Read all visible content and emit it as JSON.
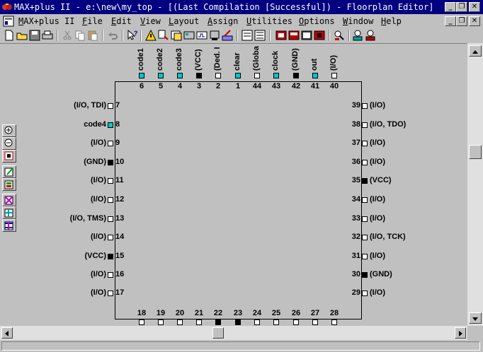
{
  "window": {
    "title": "MAX+plus II - e:\\new\\my_top - [(Last Compilation [Successful]) - Floorplan Editor]",
    "minimize_glyph": "_",
    "restore_glyph": "❐",
    "close_glyph": "✕"
  },
  "menu": {
    "items": [
      {
        "label": "MAX+plus II"
      },
      {
        "label": "File"
      },
      {
        "label": "Edit"
      },
      {
        "label": "View"
      },
      {
        "label": "Layout"
      },
      {
        "label": "Assign"
      },
      {
        "label": "Utilities"
      },
      {
        "label": "Options"
      },
      {
        "label": "Window"
      },
      {
        "label": "Help"
      }
    ]
  },
  "chip": {
    "top_pins": [
      {
        "num": "6",
        "label": "code1",
        "fill": "#00c8c8"
      },
      {
        "num": "5",
        "label": "code2",
        "fill": "#00c8c8"
      },
      {
        "num": "4",
        "label": "code3",
        "fill": "#00c8c8"
      },
      {
        "num": "3",
        "label": "(VCC)",
        "fill": "#000000"
      },
      {
        "num": "2",
        "label": "(Ded. I",
        "fill": "#ffffff"
      },
      {
        "num": "1",
        "label": "clear",
        "fill": "#00c8c8"
      },
      {
        "num": "44",
        "label": "(Globa",
        "fill": "#ffffff"
      },
      {
        "num": "43",
        "label": "clock",
        "fill": "#00c8c8"
      },
      {
        "num": "42",
        "label": "(GND)",
        "fill": "#000000"
      },
      {
        "num": "41",
        "label": "out",
        "fill": "#00c8c8"
      },
      {
        "num": "40",
        "label": "(I/O)",
        "fill": "#ffffff"
      }
    ],
    "left_pins": [
      {
        "num": "7",
        "label": "(I/O, TDI)",
        "fill": "#ffffff"
      },
      {
        "num": "8",
        "label": "code4",
        "fill": "#00c8c8"
      },
      {
        "num": "9",
        "label": "(I/O)",
        "fill": "#ffffff"
      },
      {
        "num": "10",
        "label": "(GND)",
        "fill": "#000000"
      },
      {
        "num": "11",
        "label": "(I/O)",
        "fill": "#ffffff"
      },
      {
        "num": "12",
        "label": "(I/O)",
        "fill": "#ffffff"
      },
      {
        "num": "13",
        "label": "(I/O, TMS)",
        "fill": "#ffffff"
      },
      {
        "num": "14",
        "label": "(I/O)",
        "fill": "#ffffff"
      },
      {
        "num": "15",
        "label": "(VCC)",
        "fill": "#000000"
      },
      {
        "num": "16",
        "label": "(I/O)",
        "fill": "#ffffff"
      },
      {
        "num": "17",
        "label": "(I/O)",
        "fill": "#ffffff"
      }
    ],
    "right_pins": [
      {
        "num": "39",
        "label": "(I/O)",
        "fill": "#ffffff"
      },
      {
        "num": "38",
        "label": "(I/O, TDO)",
        "fill": "#ffffff"
      },
      {
        "num": "37",
        "label": "(I/O)",
        "fill": "#ffffff"
      },
      {
        "num": "36",
        "label": "(I/O)",
        "fill": "#ffffff"
      },
      {
        "num": "35",
        "label": "(VCC)",
        "fill": "#000000"
      },
      {
        "num": "34",
        "label": "(I/O)",
        "fill": "#ffffff"
      },
      {
        "num": "33",
        "label": "(I/O)",
        "fill": "#ffffff"
      },
      {
        "num": "32",
        "label": "(I/O, TCK)",
        "fill": "#ffffff"
      },
      {
        "num": "31",
        "label": "(I/O)",
        "fill": "#ffffff"
      },
      {
        "num": "30",
        "label": "(GND)",
        "fill": "#000000"
      },
      {
        "num": "29",
        "label": "(I/O)",
        "fill": "#ffffff"
      }
    ],
    "bottom_pins": [
      {
        "num": "18",
        "fill": "#ffffff"
      },
      {
        "num": "19",
        "fill": "#ffffff"
      },
      {
        "num": "20",
        "fill": "#ffffff"
      },
      {
        "num": "21",
        "fill": "#ffffff"
      },
      {
        "num": "22",
        "fill": "#000000"
      },
      {
        "num": "23",
        "fill": "#000000"
      },
      {
        "num": "24",
        "fill": "#ffffff"
      },
      {
        "num": "25",
        "fill": "#ffffff"
      },
      {
        "num": "26",
        "fill": "#ffffff"
      },
      {
        "num": "27",
        "fill": "#ffffff"
      },
      {
        "num": "28",
        "fill": "#ffffff"
      }
    ]
  },
  "colors": {
    "titlebar": "#000080",
    "assigned_pin": "#00c8c8",
    "power_pin": "#000000",
    "unused_pin": "#ffffff"
  }
}
